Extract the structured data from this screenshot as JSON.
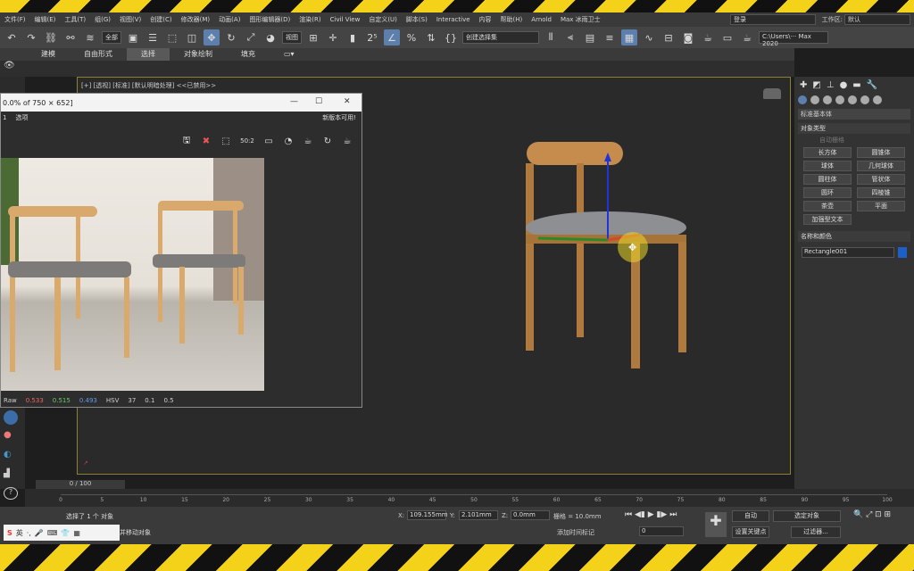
{
  "menubar": {
    "items": [
      "文件(F)",
      "编辑(E)",
      "工具(T)",
      "组(G)",
      "视图(V)",
      "创建(C)",
      "修改器(M)",
      "动画(A)",
      "图形编辑器(D)",
      "渲染(R)",
      "Civil View",
      "自定义(U)",
      "脚本(S)",
      "Interactive",
      "内容",
      "帮助(H)",
      "Arnold",
      "Max 冰雨卫士"
    ],
    "login": "登录",
    "workspace_label": "工作区:",
    "workspace_value": "默认"
  },
  "toolbar": {
    "selection_filter": "全部",
    "view_dropdown": "视图",
    "selection_set": "创建选择集",
    "path": "C:\\Users\\··· Max 2020"
  },
  "ribbon": {
    "tabs": [
      "建模",
      "自由形式",
      "选择",
      "对象绘制",
      "填充"
    ],
    "active_tab": "选择"
  },
  "viewport": {
    "label": "[+] [透视] [标准] [默认明暗处理] <<已禁用>>"
  },
  "image_window": {
    "title": "0.0% of 750 × 652]",
    "menu": [
      "1",
      "选项"
    ],
    "notice": "新版本可用!",
    "tools": [
      "save-icon",
      "clear-icon",
      "select-icon",
      "resolution-icon",
      "frame-icon",
      "channel-icon",
      "teapot-icon",
      "render-icon",
      "teapot-icon"
    ],
    "resolution_label": "50:2",
    "status": {
      "mode": "Raw",
      "r": "0.533",
      "g": "0.515",
      "b": "0.493",
      "space": "HSV",
      "h": "37",
      "s": "0.1",
      "v": "0.5"
    }
  },
  "right_panel": {
    "category": "标准基本体",
    "object_type_title": "对象类型",
    "autogrid": "自动栅格",
    "object_buttons": [
      "长方体",
      "圆锥体",
      "球体",
      "几何球体",
      "圆柱体",
      "管状体",
      "圆环",
      "四棱锥",
      "茶壶",
      "平面",
      "加强型文本"
    ],
    "name_color_title": "名称和颜色",
    "object_name": "Rectangle001",
    "object_color": "#1e5fc6"
  },
  "timeline": {
    "frame_counter": "0 / 100",
    "ticks": [
      "0",
      "5",
      "10",
      "15",
      "20",
      "25",
      "30",
      "35",
      "40",
      "45",
      "50",
      "55",
      "60",
      "65",
      "70",
      "75",
      "80",
      "85",
      "90",
      "95",
      "100"
    ]
  },
  "status": {
    "message": "选择了 1 个 对象",
    "hint": "并移动对象",
    "x_label": "X:",
    "x_value": "109.155mm",
    "y_label": "Y:",
    "y_value": "2.101mm",
    "z_label": "Z:",
    "z_value": "0.0mm",
    "grid": "栅格 = 10.0mm",
    "add_tag": "添加时间标记",
    "auto_key": "自动",
    "set_key": "设置关键点",
    "key_filter": "选定对象",
    "filters": "过滤器...",
    "frame_field": "0"
  },
  "ime": {
    "mode": "英"
  }
}
